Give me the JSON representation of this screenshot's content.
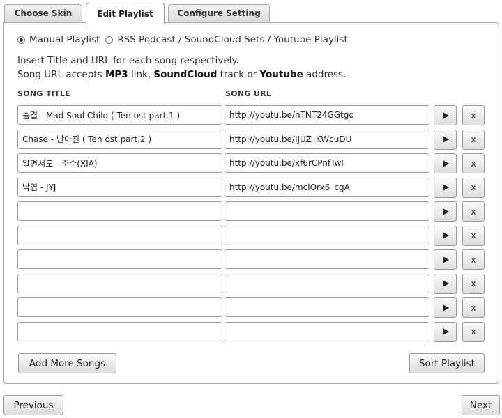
{
  "tabs": [
    {
      "label": "Choose Skin"
    },
    {
      "label": "Edit Playlist",
      "active": true
    },
    {
      "label": "Configure Setting"
    }
  ],
  "playlist_type": {
    "options": [
      {
        "label": "Manual Playlist",
        "checked": true
      },
      {
        "label": "RSS Podcast / SoundCloud Sets / Youtube Playlist",
        "checked": false
      }
    ]
  },
  "instructions": {
    "line1": "Insert Title and URL for each song respectively.",
    "line2_prefix": "Song URL accepts ",
    "line2_mp3": "MP3",
    "line2_mid1": " link, ",
    "line2_soundcloud": "SoundCloud",
    "line2_mid2": " track or ",
    "line2_youtube": "Youtube",
    "line2_suffix": " address."
  },
  "columns": {
    "title": "SONG TITLE",
    "url": "SONG URL"
  },
  "songs": [
    {
      "title": "숨결 - Mad Soul Child ( Ten ost part.1 )",
      "url": "http://youtu.be/hTNT24GGtgo"
    },
    {
      "title": "Chase - 난아진 ( Ten ost part.2 )",
      "url": "http://youtu.be/IJUZ_KWcuDU"
    },
    {
      "title": "얄면서도 - 준수(XIA)",
      "url": "http://youtu.be/xf6rCPnfTwI"
    },
    {
      "title": "낙엽 - JYJ",
      "url": "http://youtu.be/mclOrx6_cgA"
    },
    {
      "title": "",
      "url": ""
    },
    {
      "title": "",
      "url": ""
    },
    {
      "title": "",
      "url": ""
    },
    {
      "title": "",
      "url": ""
    },
    {
      "title": "",
      "url": ""
    },
    {
      "title": "",
      "url": ""
    }
  ],
  "row_buttons": {
    "play_icon": "play-icon",
    "delete_label": "x"
  },
  "buttons": {
    "add_more": "Add More Songs",
    "sort": "Sort Playlist",
    "previous": "Previous",
    "next": "Next"
  }
}
